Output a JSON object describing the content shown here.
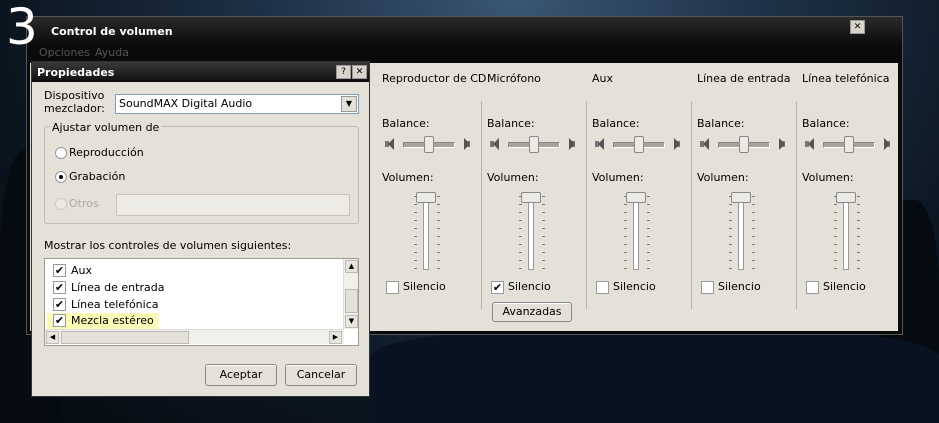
{
  "step_number": "3",
  "main_window": {
    "title": "Control de volumen",
    "menu": [
      "Opciones",
      "Ayuda"
    ],
    "columns": [
      {
        "title": "Reproductor de CD",
        "balance_label": "Balance:",
        "volume_label": "Volumen:",
        "mute_label": "Silencio",
        "mute_checked": false
      },
      {
        "title": "Micrófono",
        "balance_label": "Balance:",
        "volume_label": "Volumen:",
        "mute_label": "Silencio",
        "mute_checked": true,
        "advanced_label": "Avanzadas"
      },
      {
        "title": "Aux",
        "balance_label": "Balance:",
        "volume_label": "Volumen:",
        "mute_label": "Silencio",
        "mute_checked": false
      },
      {
        "title": "Línea de entrada",
        "balance_label": "Balance:",
        "volume_label": "Volumen:",
        "mute_label": "Silencio",
        "mute_checked": false
      },
      {
        "title": "Línea telefónica",
        "balance_label": "Balance:",
        "volume_label": "Volumen:",
        "mute_label": "Silencio",
        "mute_checked": false
      }
    ],
    "close_glyph": "✕",
    "volume_level": 1.0,
    "balance_level": 0.5
  },
  "properties": {
    "title": "Propiedades",
    "help_glyph": "?",
    "close_glyph": "✕",
    "mixer_label": "Dispositivo mezclador:",
    "mixer_value": "SoundMAX Digital Audio",
    "adjust_group": "Ajustar volumen de",
    "options": {
      "playback": "Reproducción",
      "recording": "Grabación",
      "other": "Otros"
    },
    "selected_option": "recording",
    "show_controls_label": "Mostrar los controles de volumen siguientes:",
    "items": [
      {
        "label": "Aux",
        "checked": true
      },
      {
        "label": "Línea de entrada",
        "checked": true
      },
      {
        "label": "Línea telefónica",
        "checked": true
      },
      {
        "label": "Mezcla estéreo",
        "checked": true,
        "highlighted": true
      }
    ],
    "ok_label": "Aceptar",
    "cancel_label": "Cancelar"
  },
  "colors": {
    "highlight": "#fbfbb8",
    "window_bg": "#e4e1d8"
  }
}
